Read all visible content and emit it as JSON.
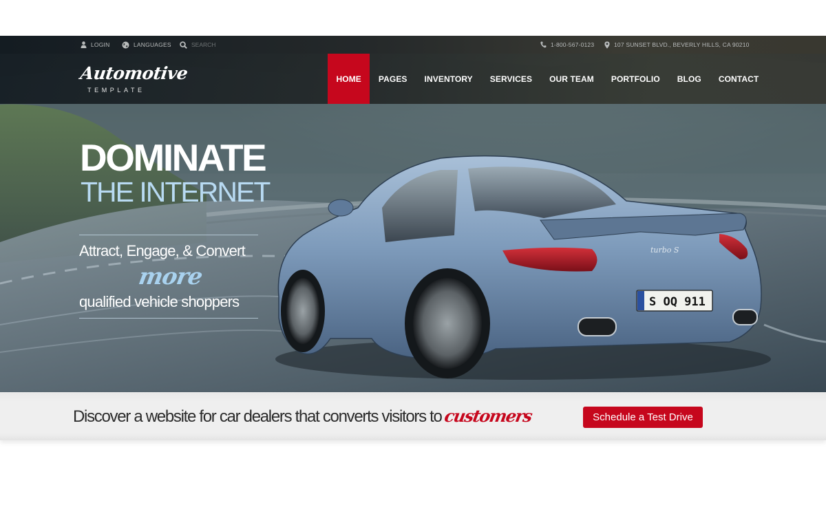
{
  "topbar": {
    "login": {
      "icon": "user-icon",
      "label": "LOGIN"
    },
    "languages": {
      "icon": "globe-icon",
      "label": "LANGUAGES"
    },
    "search": {
      "icon": "search-icon",
      "placeholder": "SEARCH",
      "value": ""
    },
    "phone": {
      "icon": "phone-icon",
      "label": "1-800-567-0123"
    },
    "address": {
      "icon": "map-pin-icon",
      "label": "107 SUNSET BLVD., BEVERLY HILLS, CA 90210"
    }
  },
  "logo": {
    "script": "Automotive",
    "sub": "TEMPLATE"
  },
  "nav": {
    "active_color": "#c6071d",
    "items": [
      {
        "label": "HOME",
        "active": true
      },
      {
        "label": "PAGES",
        "active": false
      },
      {
        "label": "INVENTORY",
        "active": false
      },
      {
        "label": "SERVICES",
        "active": false
      },
      {
        "label": "OUR TEAM",
        "active": false
      },
      {
        "label": "PORTFOLIO",
        "active": false
      },
      {
        "label": "BLOG",
        "active": false
      },
      {
        "label": "CONTACT",
        "active": false
      }
    ]
  },
  "hero": {
    "headline": "DOMINATE",
    "subheadline": "THE INTERNET",
    "tagline_1": "Attract, Engage, & Convert",
    "tagline_more": "more",
    "tagline_2": "qualified vehicle shoppers",
    "car": {
      "badge": "turbo S",
      "plate": "S OQ 911"
    }
  },
  "cta": {
    "text": "Discover a website for car dealers that converts visitors to",
    "accent": "customers",
    "accent_color": "#c6071d",
    "button_label": "Schedule a Test Drive"
  }
}
